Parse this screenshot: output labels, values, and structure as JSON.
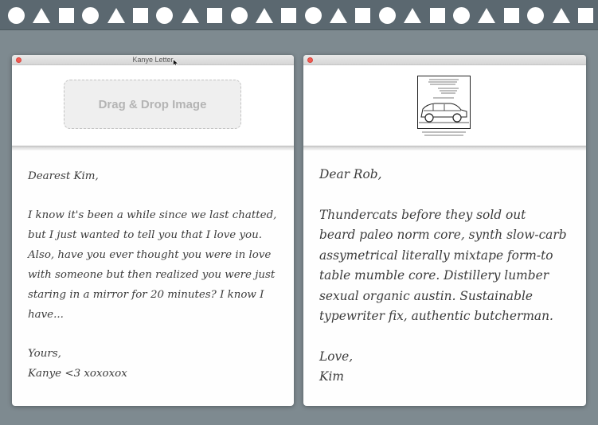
{
  "top_strip": {
    "shapes": [
      "circle",
      "triangle",
      "square",
      "circle",
      "triangle",
      "square",
      "circle",
      "triangle",
      "square",
      "circle",
      "triangle",
      "square",
      "circle",
      "triangle",
      "square",
      "circle",
      "triangle",
      "square",
      "circle",
      "triangle",
      "square",
      "circle",
      "triangle",
      "square"
    ]
  },
  "left_window": {
    "title": "Kanye Letter",
    "dropzone_label": "Drag & Drop Image",
    "greeting": "Dearest Kim,",
    "body_lines": [
      "I know it's been a while since we last chatted,",
      "but I just wanted to tell you that I love you.",
      "Also, have you ever thought you were in love",
      "with someone but then realized you were just",
      "staring in a mirror for 20 minutes? I know I",
      "have..."
    ],
    "closing": "Yours,",
    "signature": "Kanye <3 xoxoxox"
  },
  "right_window": {
    "title": "",
    "greeting": "Dear Rob,",
    "body_lines": [
      "Thundercats before they sold out",
      "beard paleo norm core, synth slow-carb",
      "assymetrical literally mixtape form-to",
      "table mumble core. Distillery lumber",
      "sexual organic austin. Sustainable",
      "typewriter fix, authentic butcherman."
    ],
    "closing": "Love,",
    "signature": "Kim"
  },
  "colors": {
    "background": "#7e8a90",
    "top_strip": "#5b6870",
    "close_button": "#f05a52"
  }
}
